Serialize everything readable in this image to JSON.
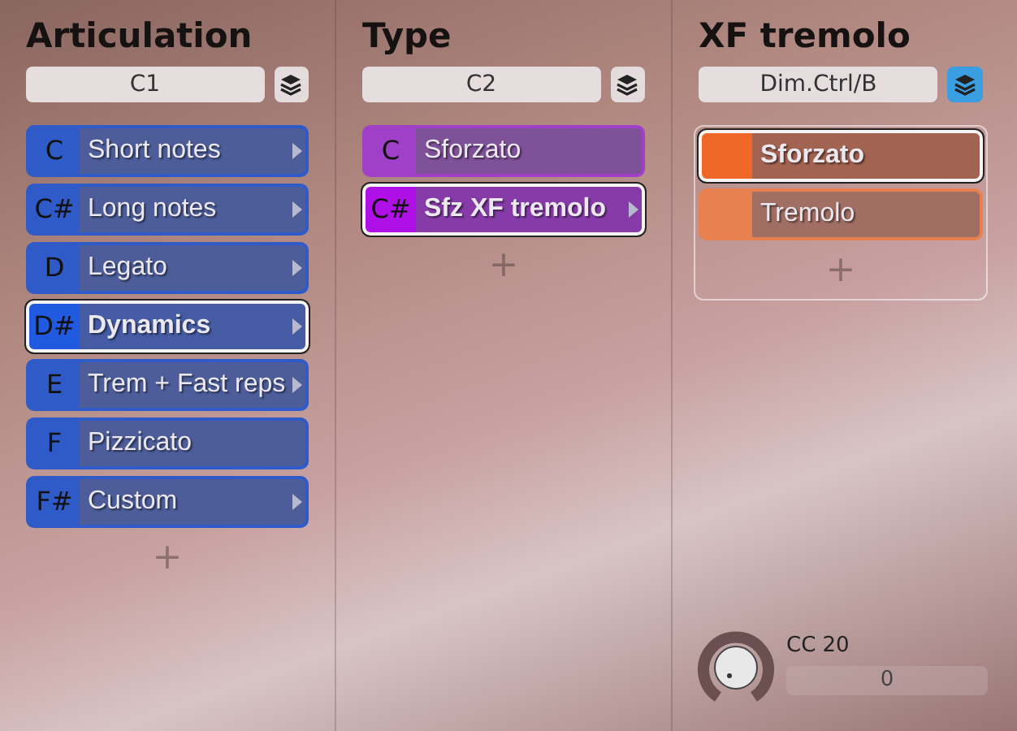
{
  "columns": [
    {
      "title": "Articulation",
      "field": "C1",
      "layers_active": false,
      "framed": false,
      "items": [
        {
          "key": "C",
          "label": "Short notes",
          "color": "#2f5bc8",
          "selected": false,
          "has_submenu": true
        },
        {
          "key": "C#",
          "label": "Long notes",
          "color": "#2f5bc8",
          "selected": false,
          "has_submenu": true
        },
        {
          "key": "D",
          "label": "Legato",
          "color": "#2f5bc8",
          "selected": false,
          "has_submenu": true
        },
        {
          "key": "D#",
          "label": "Dynamics",
          "color": "#1f5ae0",
          "selected": true,
          "has_submenu": true
        },
        {
          "key": "E",
          "label": "Trem + Fast reps",
          "color": "#2f5bc8",
          "selected": false,
          "has_submenu": true
        },
        {
          "key": "F",
          "label": "Pizzicato",
          "color": "#2f5bc8",
          "selected": false,
          "has_submenu": false
        },
        {
          "key": "F#",
          "label": "Custom",
          "color": "#2f5bc8",
          "selected": false,
          "has_submenu": true
        }
      ],
      "add": "+"
    },
    {
      "title": "Type",
      "field": "C2",
      "layers_active": false,
      "framed": false,
      "items": [
        {
          "key": "C",
          "label": "Sforzato",
          "color": "#a040c8",
          "selected": false,
          "has_submenu": false
        },
        {
          "key": "C#",
          "label": "Sfz XF tremolo",
          "color": "#b010e8",
          "selected": true,
          "has_submenu": true
        }
      ],
      "add": "+"
    },
    {
      "title": "XF tremolo",
      "field": "Dim.Ctrl/B",
      "layers_active": true,
      "framed": true,
      "items": [
        {
          "label": "Sforzato",
          "color": "#f06828",
          "selected": true,
          "has_submenu": false
        },
        {
          "label": "Tremolo",
          "color": "#e88050",
          "selected": false,
          "has_submenu": false
        }
      ],
      "add": "+",
      "knob": {
        "label": "CC 20",
        "value": "0"
      }
    }
  ]
}
